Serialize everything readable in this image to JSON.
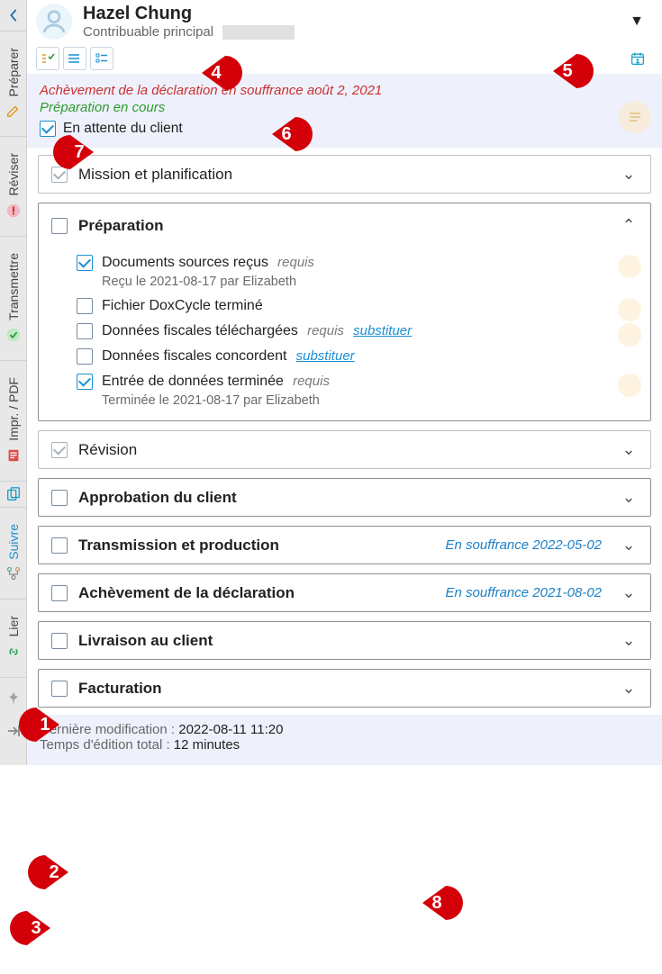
{
  "header": {
    "name": "Hazel Chung",
    "role": "Contribuable principal"
  },
  "vert_tabs": [
    {
      "id": "preparer",
      "label": "Préparer"
    },
    {
      "id": "reviser",
      "label": "Réviser"
    },
    {
      "id": "transmettre",
      "label": "Transmettre"
    },
    {
      "id": "pdf",
      "label": "Impr. / PDF"
    },
    {
      "id": "suivre",
      "label": "Suivre",
      "active": true
    },
    {
      "id": "lier",
      "label": "Lier"
    }
  ],
  "status": {
    "overdue": "Achèvement de la déclaration en souffrance  août 2, 2021",
    "progress": "Préparation en cours",
    "waiting_label": "En attente du client"
  },
  "sections": {
    "mission": {
      "title": "Mission et planification"
    },
    "preparation": {
      "title": "Préparation",
      "tasks": [
        {
          "label": "Documents sources reçus",
          "required": "requis",
          "checked": true,
          "meta": "Reçu le 2021-08-17 par Elizabeth",
          "bubble": true
        },
        {
          "label": "Fichier DoxCycle terminé",
          "checked": false,
          "bubble": true
        },
        {
          "label": "Données fiscales téléchargées",
          "required": "requis",
          "substitute": "substituer",
          "checked": false,
          "bubble": true
        },
        {
          "label": "Données fiscales concordent",
          "substitute": "substituer",
          "checked": false
        },
        {
          "label": "Entrée de données terminée",
          "required": "requis",
          "checked": true,
          "meta": "Terminée le 2021-08-17 par Elizabeth",
          "bubble": true
        }
      ]
    },
    "revision": {
      "title": "Révision"
    },
    "approbation": {
      "title": "Approbation du client"
    },
    "transmission": {
      "title": "Transmission et production",
      "status": "En souffrance 2022-05-02"
    },
    "achevement": {
      "title": "Achèvement de la déclaration",
      "status": "En souffrance 2021-08-02"
    },
    "livraison": {
      "title": "Livraison au client"
    },
    "facturation": {
      "title": "Facturation"
    }
  },
  "footer": {
    "last_mod_label": "Dernière modification : ",
    "last_mod_value": "2022-08-11 11:20",
    "edit_time_label": "Temps d'édition total : ",
    "edit_time_value": "12 minutes"
  },
  "callouts": {
    "1": "1",
    "2": "2",
    "3": "3",
    "4": "4",
    "5": "5",
    "6": "6",
    "7": "7",
    "8": "8"
  }
}
